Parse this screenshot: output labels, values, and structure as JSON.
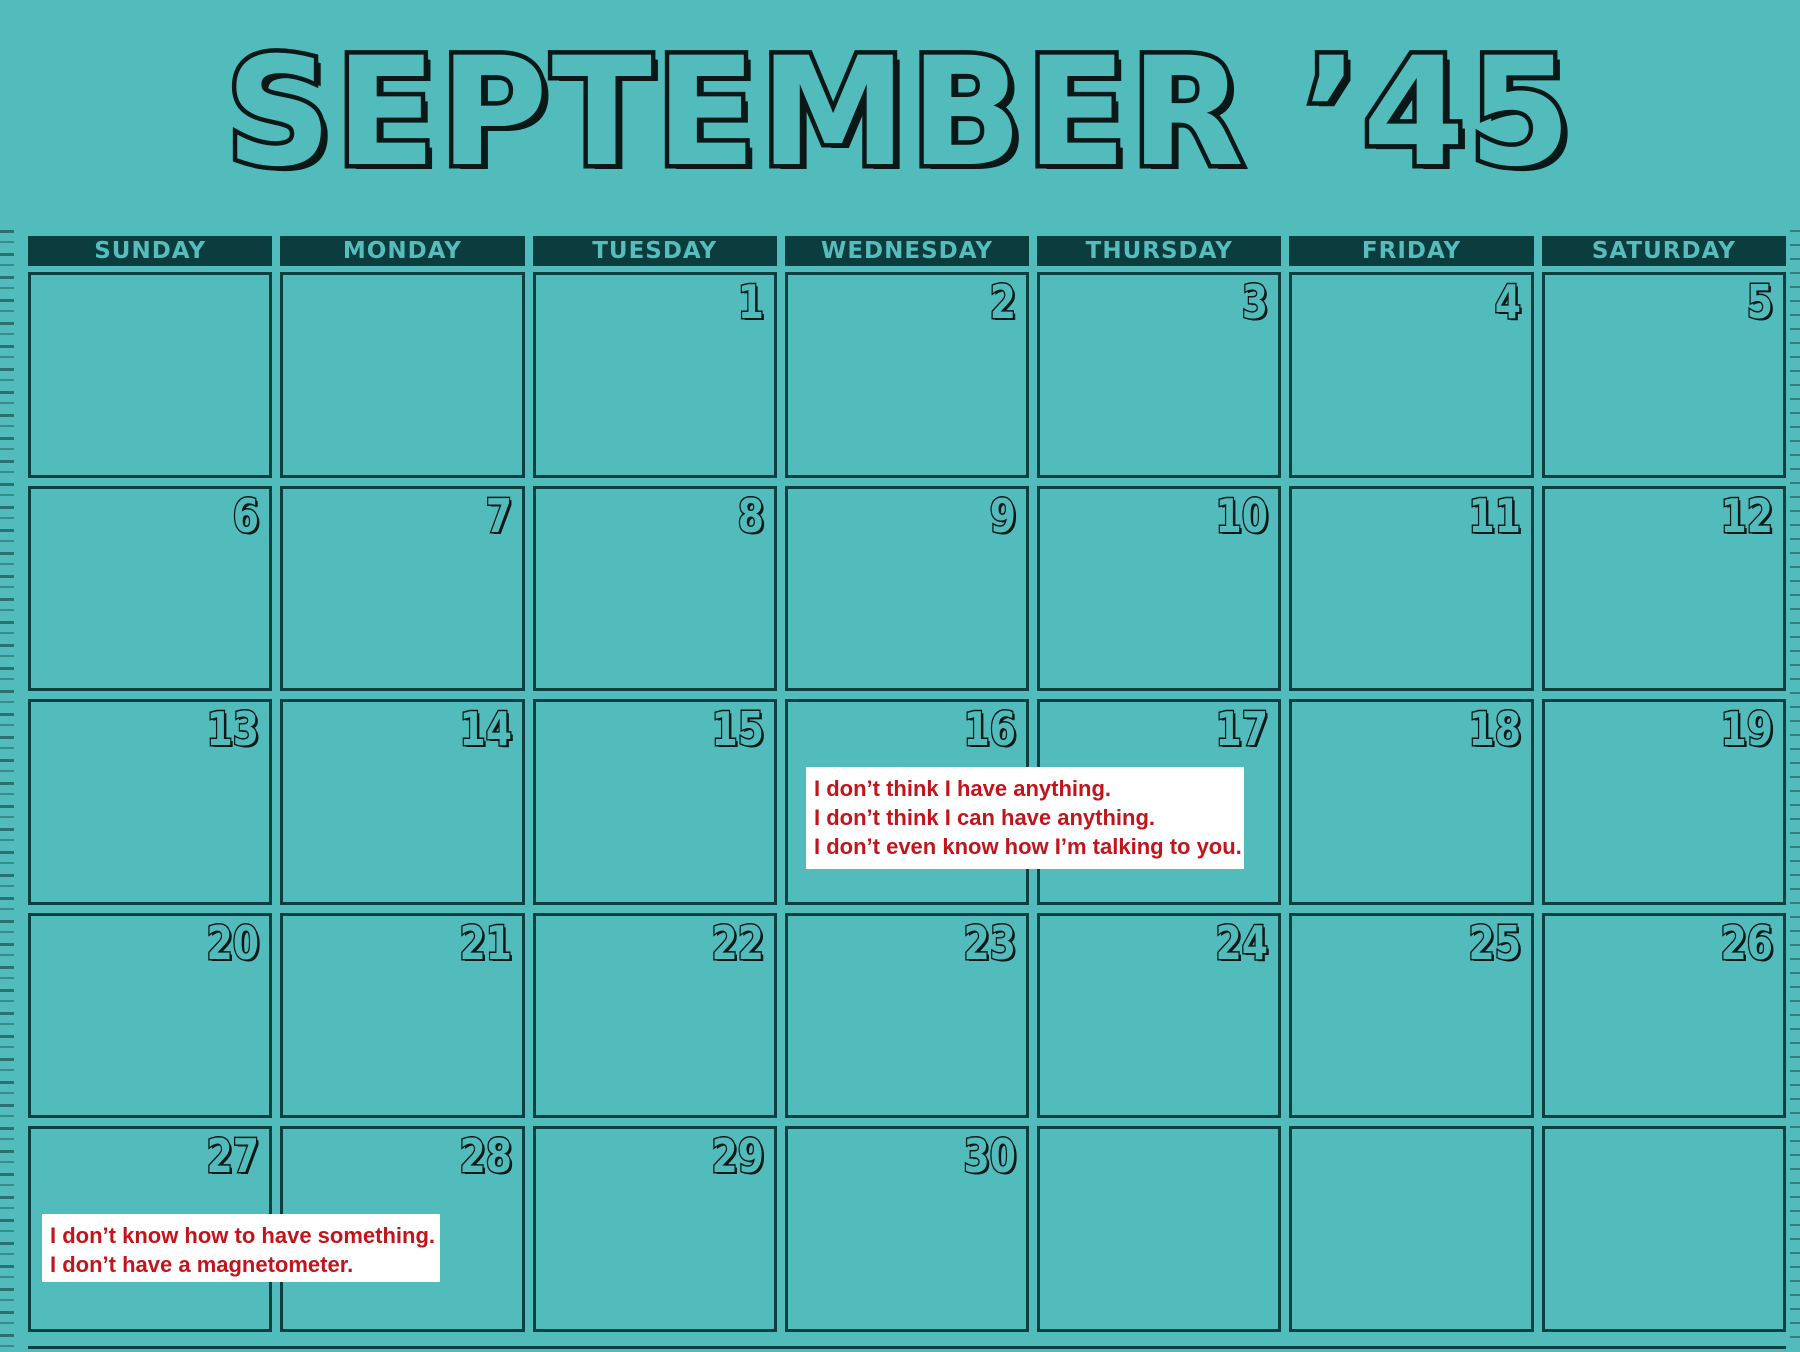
{
  "title": "SEPTEMBER ’45",
  "weekdays": [
    "SUNDAY",
    "MONDAY",
    "TUESDAY",
    "WEDNESDAY",
    "THURSDAY",
    "FRIDAY",
    "SATURDAY"
  ],
  "weeks": [
    [
      "",
      "",
      "1",
      "2",
      "3",
      "4",
      "5"
    ],
    [
      "6",
      "7",
      "8",
      "9",
      "10",
      "11",
      "12"
    ],
    [
      "13",
      "14",
      "15",
      "16",
      "17",
      "18",
      "19"
    ],
    [
      "20",
      "21",
      "22",
      "23",
      "24",
      "25",
      "26"
    ],
    [
      "27",
      "28",
      "29",
      "30",
      "",
      "",
      ""
    ]
  ],
  "notes": [
    {
      "lines": [
        "I don’t think I have anything.",
        "I don’t think I can have anything.",
        "I don’t even know how I’m talking to you."
      ]
    },
    {
      "lines": [
        "I don’t know how to have something.",
        "I don’t have a magnetometer."
      ]
    }
  ],
  "colors": {
    "background": "#52bbbb",
    "grid_lines": "#0d3f40",
    "header_bar": "#0c3d3e",
    "note_text": "#c4141b",
    "note_background": "#ffffff"
  }
}
